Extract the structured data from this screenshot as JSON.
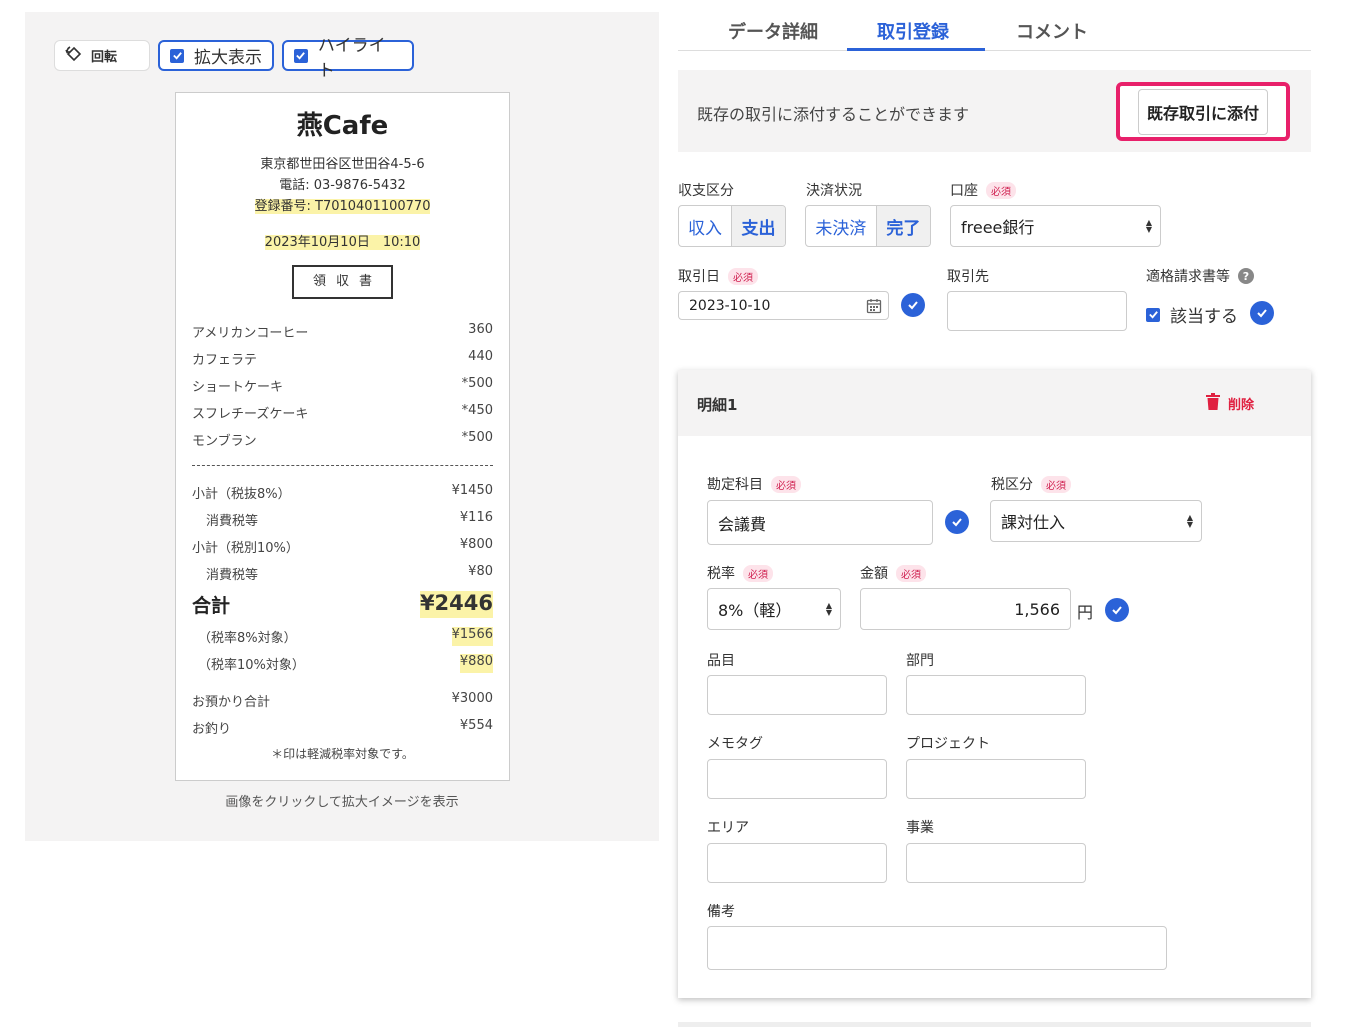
{
  "left": {
    "toolbar": {
      "rotate": "回転",
      "zoom": "拡大表示",
      "highlight": "ハイライト"
    },
    "receipt": {
      "shop": "燕Cafe",
      "address": "東京都世田谷区世田谷4-5-6",
      "phone": "電話: 03-9876-5432",
      "registration": "登録番号: T7010401100770",
      "datetime": "2023年10月10日　10:10",
      "stamp": "領収書",
      "items": [
        {
          "name": "アメリカンコーヒー",
          "price": "360"
        },
        {
          "name": "カフェラテ",
          "price": "440"
        },
        {
          "name": "ショートケーキ",
          "price": "*500"
        },
        {
          "name": "スフレチーズケーキ",
          "price": "*450"
        },
        {
          "name": "モンブラン",
          "price": "*500"
        }
      ],
      "subtotals": [
        {
          "name": "小計（税抜8%）",
          "price": "¥1450"
        },
        {
          "name": "消費税等",
          "price": "¥116"
        },
        {
          "name": "小計（税別10%）",
          "price": "¥800"
        },
        {
          "name": "消費税等",
          "price": "¥80"
        }
      ],
      "total_label": "合計",
      "total_value": "¥2446",
      "breakdown": [
        {
          "name": "（税率8%対象）",
          "price": "¥1566"
        },
        {
          "name": "（税率10%対象）",
          "price": "¥880"
        }
      ],
      "deposit_label": "お預かり合計",
      "deposit_value": "¥3000",
      "change_label": "お釣り",
      "change_value": "¥554",
      "footnote": "＊印は軽減税率対象です。"
    },
    "caption": "画像をクリックして拡大イメージを表示"
  },
  "tabs": [
    "データ詳細",
    "取引登録",
    "コメント"
  ],
  "notice": {
    "text": "既存の取引に添付することができます",
    "button": "既存取引に添付"
  },
  "form": {
    "income_type": {
      "label": "収支区分",
      "options": [
        "収入",
        "支出"
      ]
    },
    "settlement": {
      "label": "決済状況",
      "options": [
        "未決済",
        "完了"
      ]
    },
    "account": {
      "label": "口座",
      "value": "freee銀行"
    },
    "required": "必須",
    "date": {
      "label": "取引日",
      "value": "2023-10-10"
    },
    "partner": {
      "label": "取引先",
      "value": ""
    },
    "invoice": {
      "label": "適格請求書等",
      "check_label": "該当する"
    }
  },
  "detail": {
    "title": "明細1",
    "delete": "削除",
    "account_item": {
      "label": "勘定科目",
      "value": "会議費"
    },
    "tax_category": {
      "label": "税区分",
      "value": "課対仕入"
    },
    "tax_rate": {
      "label": "税率",
      "value": "8%（軽）"
    },
    "amount": {
      "label": "金額",
      "value": "1,566",
      "unit": "円"
    },
    "item": "品目",
    "department": "部門",
    "memo_tag": "メモタグ",
    "project": "プロジェクト",
    "area": "エリア",
    "business": "事業",
    "remarks": "備考"
  }
}
